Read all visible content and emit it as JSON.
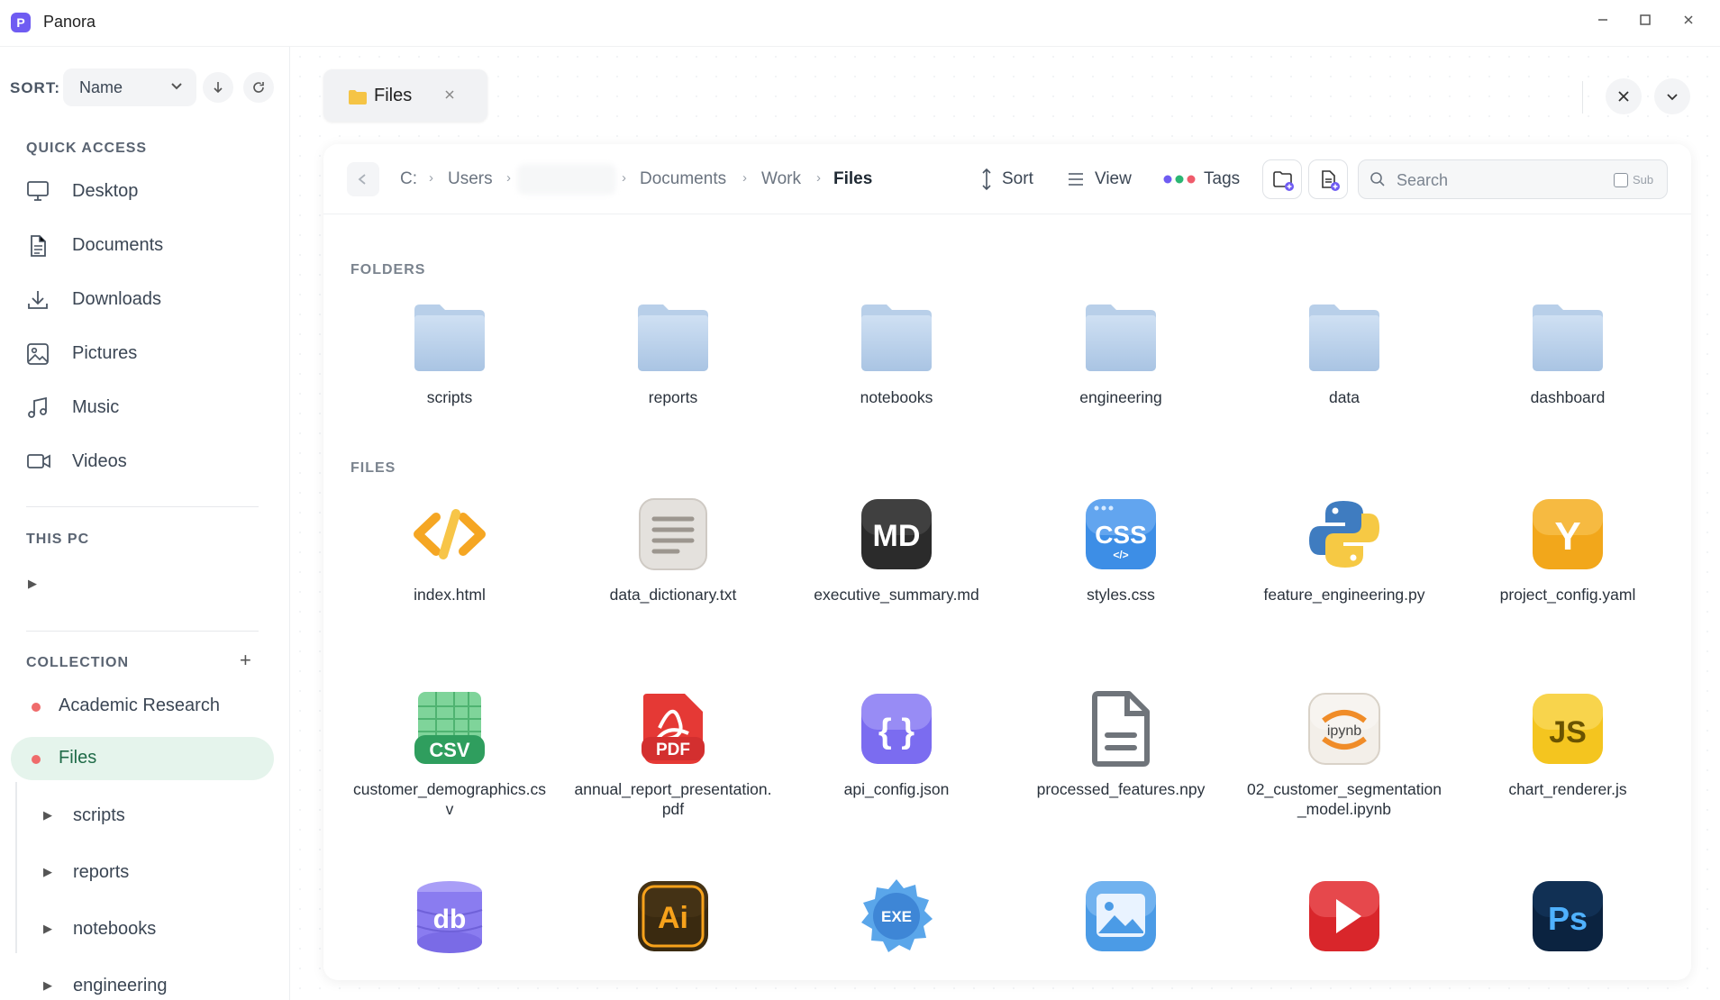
{
  "app": {
    "title": "Panora",
    "logo_letter": "P"
  },
  "window": {
    "minimize": "—",
    "maximize": "☐",
    "close": "✕"
  },
  "sidebar": {
    "sort_label": "SORT:",
    "sort_value": "Name",
    "quick_access_title": "QUICK ACCESS",
    "quick_access": [
      {
        "label": "Desktop",
        "icon": "monitor-icon"
      },
      {
        "label": "Documents",
        "icon": "document-icon"
      },
      {
        "label": "Downloads",
        "icon": "download-icon"
      },
      {
        "label": "Pictures",
        "icon": "image-icon"
      },
      {
        "label": "Music",
        "icon": "music-icon"
      },
      {
        "label": "Videos",
        "icon": "video-icon"
      }
    ],
    "this_pc_title": "THIS PC",
    "this_pc_toggle": "▶",
    "collection_title": "COLLECTION",
    "collection_add": "+",
    "collections": [
      {
        "label": "Academic Research",
        "color": "#ef6b6b"
      },
      {
        "label": "Files",
        "color": "#ef6b6b",
        "active": true
      }
    ],
    "tree": [
      {
        "toggle": "▶",
        "label": "scripts"
      },
      {
        "toggle": "▶",
        "label": "reports"
      },
      {
        "toggle": "▶",
        "label": "notebooks"
      },
      {
        "toggle": "▶",
        "label": "engineering"
      }
    ]
  },
  "tabs": [
    {
      "label": "Files",
      "close": "✕"
    }
  ],
  "breadcrumb": {
    "items": [
      "C:",
      "Users",
      "Documents",
      "Work",
      "Files"
    ],
    "separator": "›"
  },
  "toolbar": {
    "sort_label": "Sort",
    "view_label": "View",
    "tags_label": "Tags",
    "search_placeholder": "Search",
    "sub_label": "Sub"
  },
  "sections": {
    "folders_title": "FOLDERS",
    "files_title": "FILES"
  },
  "folders": [
    "scripts",
    "reports",
    "notebooks",
    "engineering",
    "data",
    "dashboard"
  ],
  "files": [
    {
      "name": "index.html",
      "icon": "html-file-icon",
      "badge": "</>"
    },
    {
      "name": "data_dictionary.txt",
      "icon": "txt-file-icon",
      "badge": ""
    },
    {
      "name": "executive_summary.md",
      "icon": "markdown-file-icon",
      "badge": "MD"
    },
    {
      "name": "styles.css",
      "icon": "css-file-icon",
      "badge": "CSS"
    },
    {
      "name": "feature_engineering.py",
      "icon": "python-file-icon",
      "badge": ""
    },
    {
      "name": "project_config.yaml",
      "icon": "yaml-file-icon",
      "badge": "Y"
    },
    {
      "name": "customer_demographics.csv",
      "icon": "csv-file-icon",
      "badge": "CSV"
    },
    {
      "name": "annual_report_presentation.pdf",
      "icon": "pdf-file-icon",
      "badge": "PDF"
    },
    {
      "name": "api_config.json",
      "icon": "json-file-icon",
      "badge": "{ }"
    },
    {
      "name": "processed_features.npy",
      "icon": "generic-file-icon",
      "badge": ""
    },
    {
      "name": "02_customer_segmentation_model.ipynb",
      "icon": "notebook-file-icon",
      "badge": "ipynb"
    },
    {
      "name": "chart_renderer.js",
      "icon": "js-file-icon",
      "badge": "JS"
    },
    {
      "name": "",
      "icon": "database-file-icon",
      "badge": "db"
    },
    {
      "name": "",
      "icon": "illustrator-file-icon",
      "badge": "Ai"
    },
    {
      "name": "",
      "icon": "exe-file-icon",
      "badge": "EXE"
    },
    {
      "name": "",
      "icon": "image-file-icon",
      "badge": ""
    },
    {
      "name": "",
      "icon": "video-file-icon",
      "badge": ""
    },
    {
      "name": "",
      "icon": "photoshop-file-icon",
      "badge": "Ps"
    }
  ],
  "colors": {
    "accent": "#6f5cf2",
    "active_bg": "#e5f4ec",
    "active_text": "#1f6b48",
    "tag_red": "#ef6b6b"
  }
}
